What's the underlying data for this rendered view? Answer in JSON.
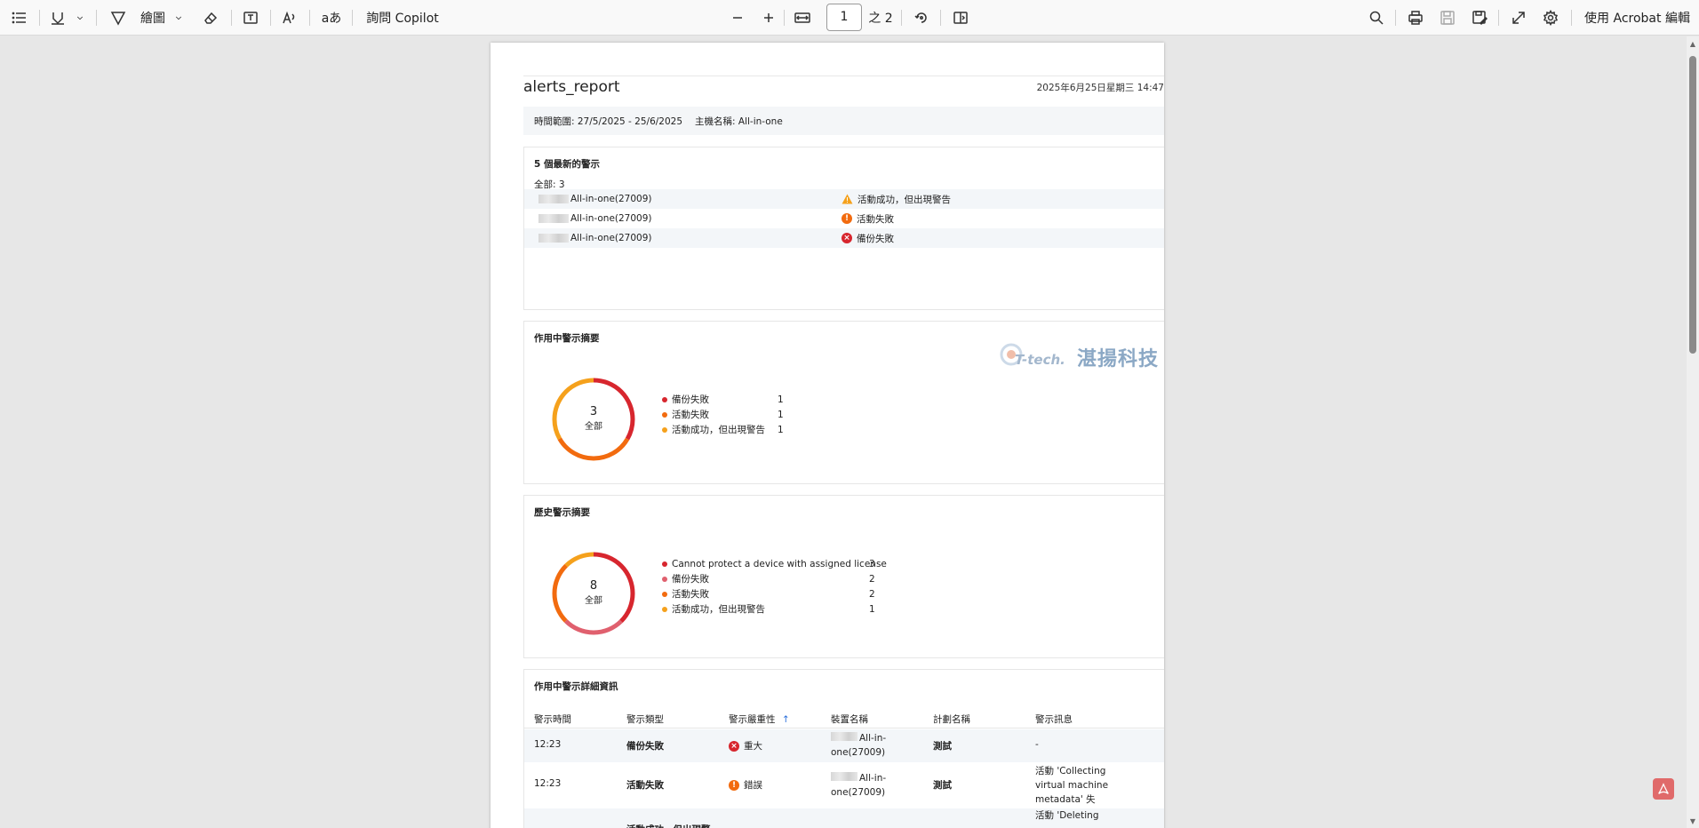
{
  "toolbar": {
    "draw_label": "繪圖",
    "read_label": "aあ",
    "copilot_label": "詢問 Copilot",
    "page_current": "1",
    "page_total": "之 2",
    "acrobat_label": "使用 Acrobat 編輯"
  },
  "report": {
    "title": "alerts_report",
    "date": "2025年6月25日星期三 14:47",
    "time_range": "時間範圍: 27/5/2025 - 25/6/2025",
    "host_name": "主機名稱: All-in-one"
  },
  "latest": {
    "title": "5 個最新的警示",
    "total": "全部: 3",
    "rows": [
      {
        "host": "All-in-one(27009)",
        "status": "活動成功，但出現警告",
        "icon": "warning-icon"
      },
      {
        "host": "All-in-one(27009)",
        "status": "活動失敗",
        "icon": "error-icon"
      },
      {
        "host": "All-in-one(27009)",
        "status": "備份失敗",
        "icon": "critical-icon"
      }
    ]
  },
  "active_summary": {
    "title": "作用中警示摘要",
    "total": "3",
    "total_label": "全部",
    "legend": [
      {
        "label": "備份失敗",
        "value": "1",
        "color": "#d7262e"
      },
      {
        "label": "活動失敗",
        "value": "1",
        "color": "#f26b0f"
      },
      {
        "label": "活動成功，但出現警告",
        "value": "1",
        "color": "#f5a11c"
      }
    ]
  },
  "history_summary": {
    "title": "歷史警示摘要",
    "total": "8",
    "total_label": "全部",
    "legend": [
      {
        "label": "Cannot protect a device with assigned license",
        "value": "3",
        "color": "#d7262e"
      },
      {
        "label": "備份失敗",
        "value": "2",
        "color": "#e0606e"
      },
      {
        "label": "活動失敗",
        "value": "2",
        "color": "#f26b0f"
      },
      {
        "label": "活動成功，但出現警告",
        "value": "1",
        "color": "#f5a11c"
      }
    ]
  },
  "details": {
    "title": "作用中警示詳細資訊",
    "headers": [
      "警示時間",
      "警示類型",
      "警示嚴重性",
      "裝置名稱",
      "計劃名稱",
      "警示訊息"
    ],
    "sort_indicator": "↑",
    "rows": [
      {
        "time": "12:23",
        "type": "備份失敗",
        "severity": "重大",
        "device": "All-in-one(27009)",
        "plan": "測試",
        "message": "-"
      },
      {
        "time": "12:23",
        "type": "活動失敗",
        "severity": "錯誤",
        "device": "All-in-one(27009)",
        "plan": "測試",
        "message": "活動 'Collecting virtual machine metadata' 失敗。"
      },
      {
        "time": "",
        "type": "活動成功，但出現警",
        "severity": "",
        "device": "",
        "plan": "",
        "message": "活動 'Deleting"
      }
    ]
  },
  "watermark": {
    "brand": "湛揚科技",
    "logo_text": "T-tech."
  },
  "colors": {
    "critical": "#d7262e",
    "error": "#f26b0f",
    "warning": "#f5a11c",
    "backup_fail_hist": "#e0606e"
  }
}
